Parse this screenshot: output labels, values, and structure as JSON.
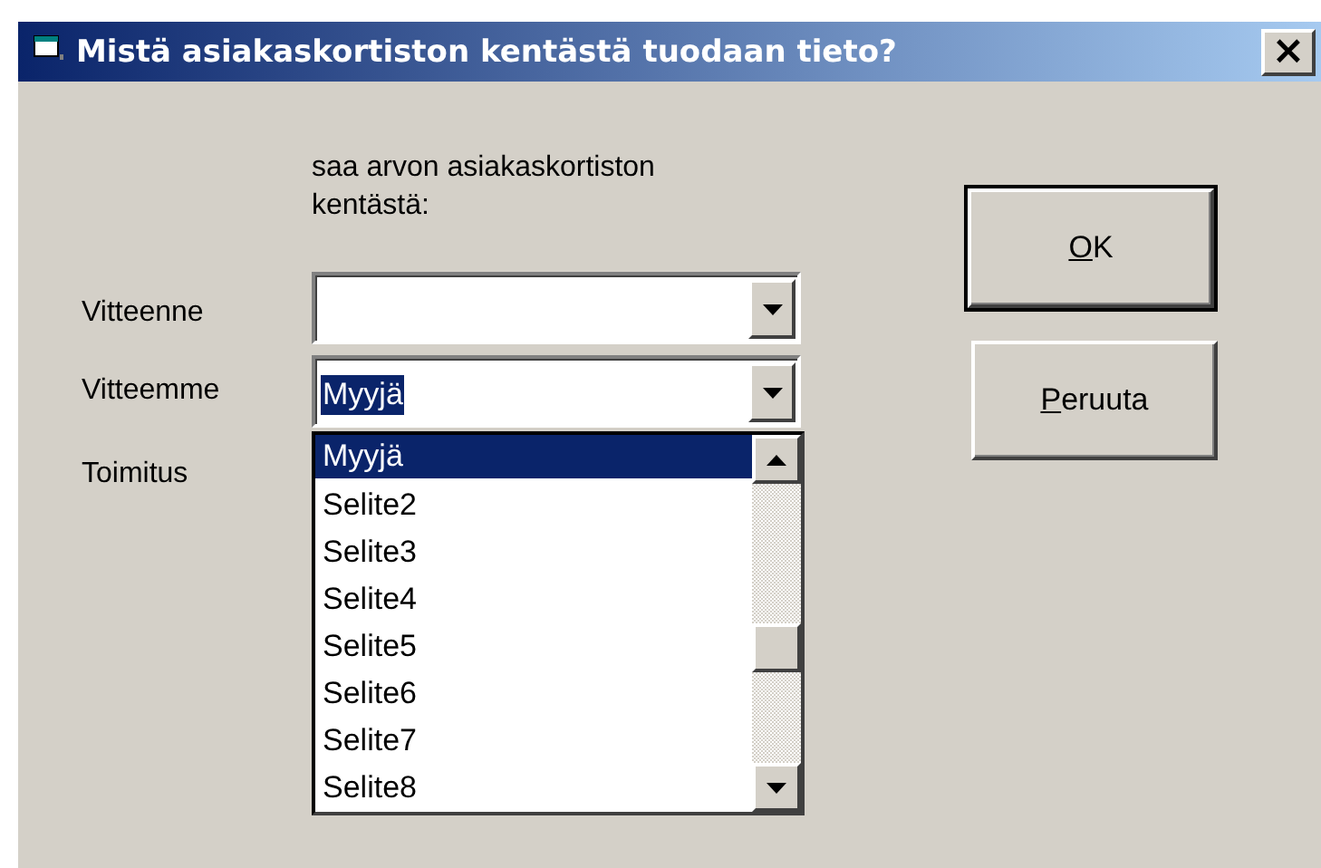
{
  "window": {
    "title": "Mistä asiakaskortiston kentästä tuodaan tieto?",
    "close_button": "×"
  },
  "caption": "saa arvon asiakaskortiston kentästä:",
  "fields": [
    {
      "label": "Vitteenne"
    },
    {
      "label": "Vitteemme",
      "value": "Myyjä",
      "text_selected": true,
      "dropdown": {
        "items": [
          {
            "text": "Myyjä",
            "selected": true
          },
          {
            "text": "Selite2",
            "selected": false
          },
          {
            "text": "Selite3",
            "selected": false
          },
          {
            "text": "Selite4",
            "selected": false
          },
          {
            "text": "Selite5",
            "selected": false
          },
          {
            "text": "Selite6",
            "selected": false
          },
          {
            "text": "Selite7",
            "selected": false
          },
          {
            "text": "Selite8",
            "selected": false
          }
        ]
      }
    },
    {
      "label": "Toimitus"
    }
  ],
  "buttons": [
    {
      "label": "OK",
      "default": true
    },
    {
      "label": "Peruuta",
      "default": false
    }
  ]
}
